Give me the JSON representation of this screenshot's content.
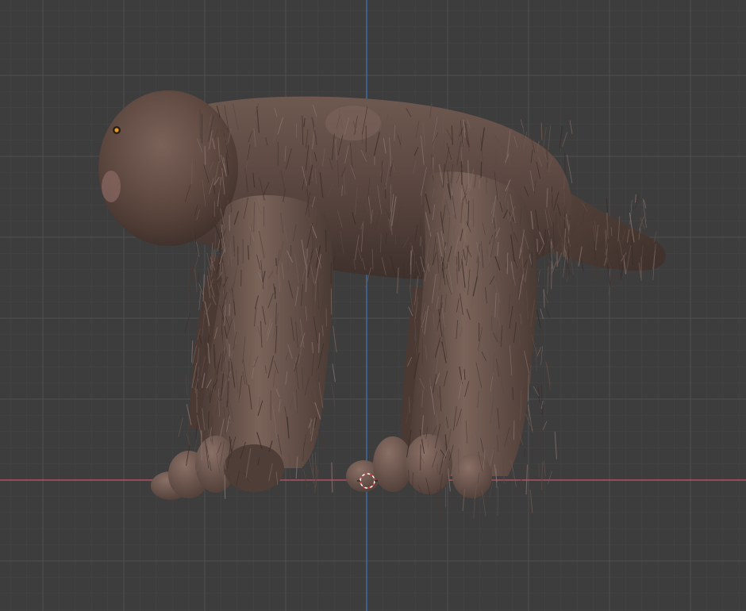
{
  "viewport": {
    "background_color": "#3d3d3d",
    "grid_minor_color": "#454545",
    "grid_major_color": "#505050",
    "x_axis_color": "#b3525e",
    "z_axis_color": "#3f6ba5"
  },
  "scene": {
    "object": "furry-creature",
    "fur_color": "#5a473f",
    "skin_color": "#6b554c",
    "eye_color": "#e0a020",
    "origin_marker": "3d-cursor-icon"
  }
}
